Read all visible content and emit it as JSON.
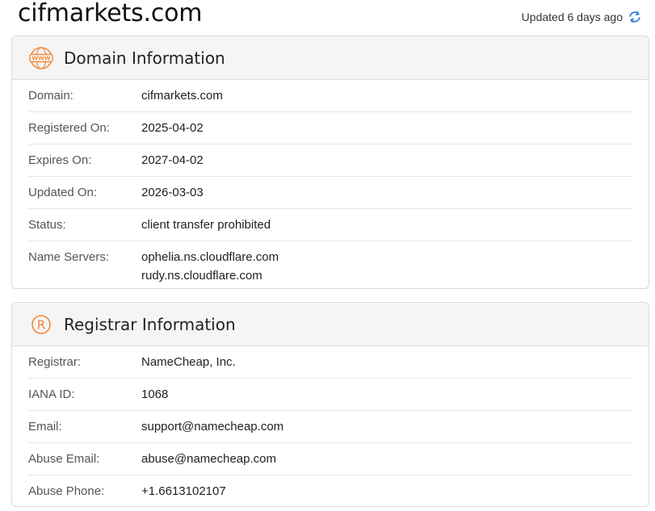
{
  "site": {
    "title": "cifmarkets.com"
  },
  "updated": {
    "text": "Updated 6 days ago"
  },
  "domain_section": {
    "title": "Domain Information",
    "icon": "www-icon",
    "rows": [
      {
        "label": "Domain:",
        "value": "cifmarkets.com"
      },
      {
        "label": "Registered On:",
        "value": "2025-04-02"
      },
      {
        "label": "Expires On:",
        "value": "2027-04-02"
      },
      {
        "label": "Updated On:",
        "value": "2026-03-03"
      },
      {
        "label": "Status:",
        "value": "client transfer prohibited"
      },
      {
        "label": "Name Servers:",
        "values": [
          "ophelia.ns.cloudflare.com",
          "rudy.ns.cloudflare.com"
        ]
      }
    ]
  },
  "registrar_section": {
    "title": "Registrar Information",
    "icon": "registered-icon",
    "rows": [
      {
        "label": "Registrar:",
        "value": "NameCheap, Inc."
      },
      {
        "label": "IANA ID:",
        "value": "1068"
      },
      {
        "label": "Email:",
        "value": "support@namecheap.com"
      },
      {
        "label": "Abuse Email:",
        "value": "abuse@namecheap.com"
      },
      {
        "label": "Abuse Phone:",
        "value": "+1.6613102107"
      }
    ]
  },
  "colors": {
    "accent": "#f0883a",
    "refresh": "#3a7fd8"
  }
}
